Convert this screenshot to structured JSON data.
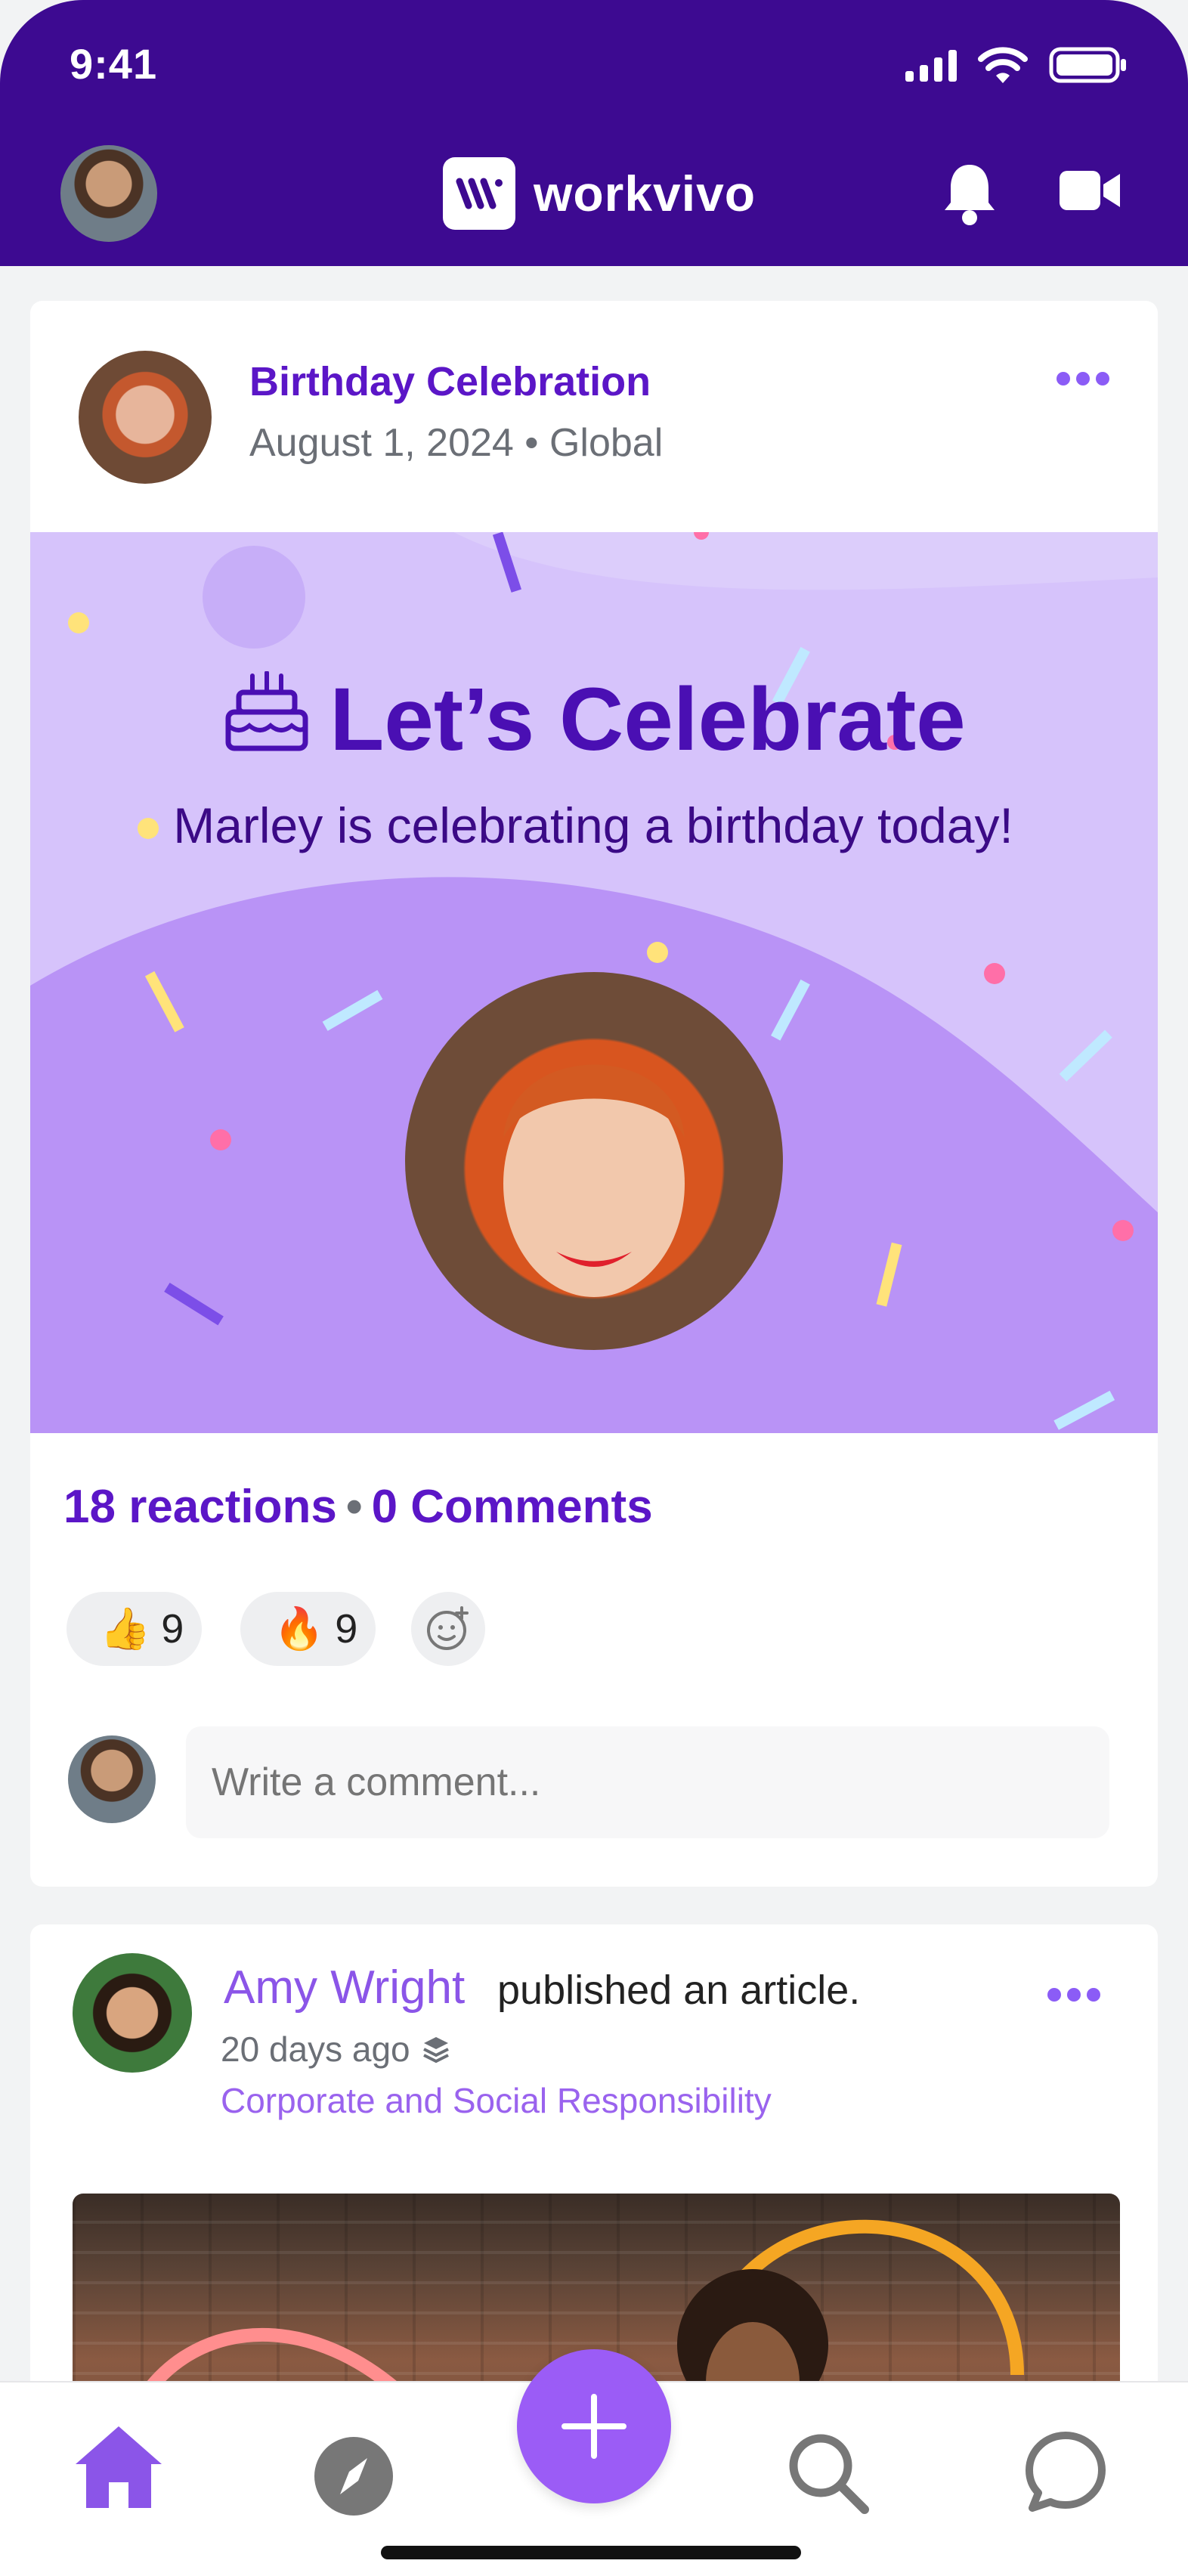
{
  "status_bar": {
    "time": "9:41"
  },
  "header": {
    "logo_text": "workvivo"
  },
  "birthday_post": {
    "title": "Birthday Celebration",
    "date": "August 1, 2024",
    "audience": "Global",
    "banner_title": "Let’s Celebrate",
    "banner_subtitle": "Marley is celebrating a birthday today!",
    "reactions_label": "18 reactions",
    "comments_label": "0 Comments",
    "reactions": [
      {
        "emoji": "👍",
        "count": "9"
      },
      {
        "emoji": "🔥",
        "count": "9"
      }
    ],
    "comment_placeholder": "Write a comment..."
  },
  "article_post": {
    "author": "Amy Wright",
    "action": "published an article.",
    "time": "20 days ago",
    "tag": "Corporate and Social Responsibility"
  },
  "colors": {
    "brand": "#3d0a91",
    "accent": "#9b5cf6",
    "link": "#5b16c7"
  },
  "tabbar": {
    "tabs": [
      "home-icon",
      "compass-icon",
      "plus-icon",
      "search-icon",
      "chat-icon"
    ]
  }
}
